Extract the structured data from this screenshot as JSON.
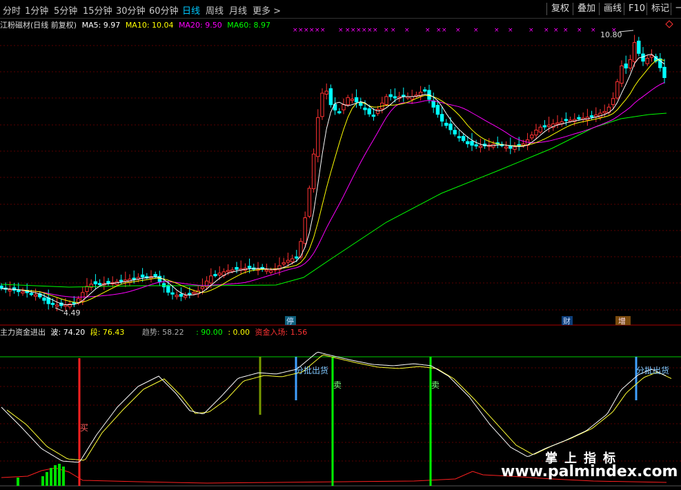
{
  "toolbar": {
    "periods": [
      "分时",
      "1分钟",
      "5分钟",
      "15分钟",
      "30分钟",
      "60分钟",
      "日线",
      "周线",
      "月线",
      "更多"
    ],
    "more_arrow": ">",
    "active_period": "日线",
    "right_buttons": [
      "复权",
      "叠加",
      "画线",
      "F10",
      "标记",
      "一图"
    ]
  },
  "price_legend": {
    "title": "江粉磁材(日线 前复权)",
    "ma5": "MA5: 9.97",
    "ma10": "MA10: 10.04",
    "ma20": "MA20: 9.50",
    "ma60": "MA60: 8.97"
  },
  "price_annotations": {
    "low": "4.49",
    "high": "10.80",
    "marker_stop": "停",
    "marker_fin": "财",
    "marker_add": "增"
  },
  "indicator_legend": {
    "title": "主力资金进出",
    "wave": "波: 74.20",
    "segment": "段: 76.43",
    "trend": "趋势: 58.22",
    "v90": ": 90.00",
    "v0": ": 0.00",
    "inflow": "资金入场: 1.56"
  },
  "indicator_signals": {
    "buy": "买",
    "sell1": "卖",
    "sell2": "卖",
    "batch1": "分批出货",
    "batch2": "分批出货"
  },
  "watermark": {
    "line1": "掌上指标",
    "line2": "www.palmindex.com"
  },
  "colors": {
    "up": "#ff3232",
    "down": "#00ffff",
    "ma5": "#ffffff",
    "ma10": "#ffff00",
    "ma20": "#ff00ff",
    "ma60": "#00ff00"
  }
}
